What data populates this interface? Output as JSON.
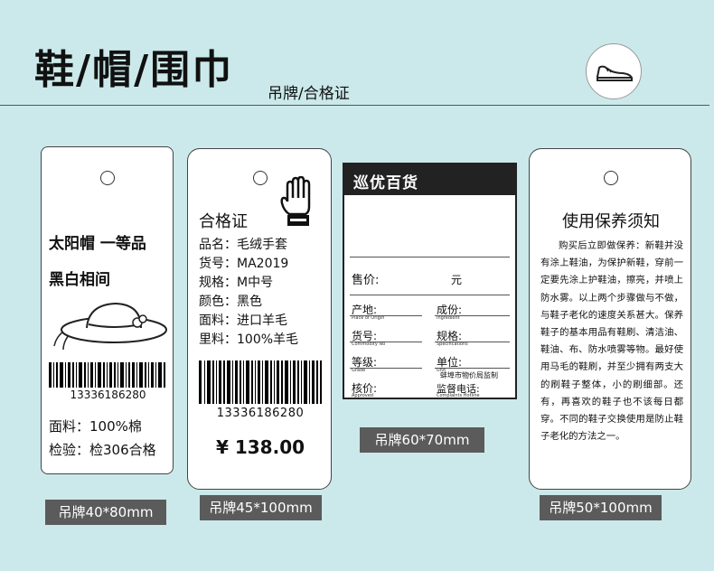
{
  "header": {
    "title": "鞋/帽/围巾",
    "subtitle": "吊牌/合格证",
    "icon": "sneaker-icon"
  },
  "tag1": {
    "line1": "太阳帽 一等品",
    "line2": "黑白相间",
    "barcode": "13336186280",
    "field1": "面料：100%棉",
    "field2": "检验：检306合格",
    "size": "吊牌40*80mm"
  },
  "tag2": {
    "title": "合格证",
    "rows": [
      "品名：毛绒手套",
      "货号：MA2019",
      "规格：M中号",
      "颜色：黑色",
      "面料：进口羊毛",
      "里料：100%羊毛"
    ],
    "barcode": "13336186280",
    "price": "¥ 138.00",
    "size": "吊牌45*100mm"
  },
  "tag3": {
    "brand": "巡优百货",
    "price_label": "售价:",
    "price_unit": "元",
    "origin_label": "产地:",
    "origin_en": "Place of Origin",
    "grade2_label": "成份:",
    "grade2_en": "Ingredient",
    "item_label": "货号:",
    "item_en": "Commodity No",
    "spec_label": "规格:",
    "spec_en": "Specifications",
    "grade_label": "等级:",
    "grade_en": "Grade",
    "unit_label": "单位:",
    "unit_en": "Unit",
    "checker_label": "核价:",
    "checker_en": "Approved",
    "bureau": "蚌埠市物价局监制",
    "hotline_label": "监督电话:",
    "hotline_en": "Complaints Hotline",
    "size": "吊牌60*70mm"
  },
  "tag4": {
    "title": "使用保养须知",
    "body": "购买后立即做保养：新鞋并没有涂上鞋油，为保护新鞋，穿前一定要先涂上护鞋油，擦亮，并喷上防水雾。以上两个步骤做与不做，与鞋子老化的速度关系甚大。保养鞋子的基本用品有鞋刷、清洁油、鞋油、布、防水喷雾等物。最好使用马毛的鞋刷，并至少拥有两支大的刷鞋子整体，小的刷细部。还有，再喜欢的鞋子也不该每日都穿。不同的鞋子交换使用是防止鞋子老化的方法之一。",
    "size": "吊牌50*100mm"
  },
  "colors": {
    "background": "#cbe9ea",
    "label_bg": "#5b5b5b",
    "brand_bg": "#222222"
  }
}
